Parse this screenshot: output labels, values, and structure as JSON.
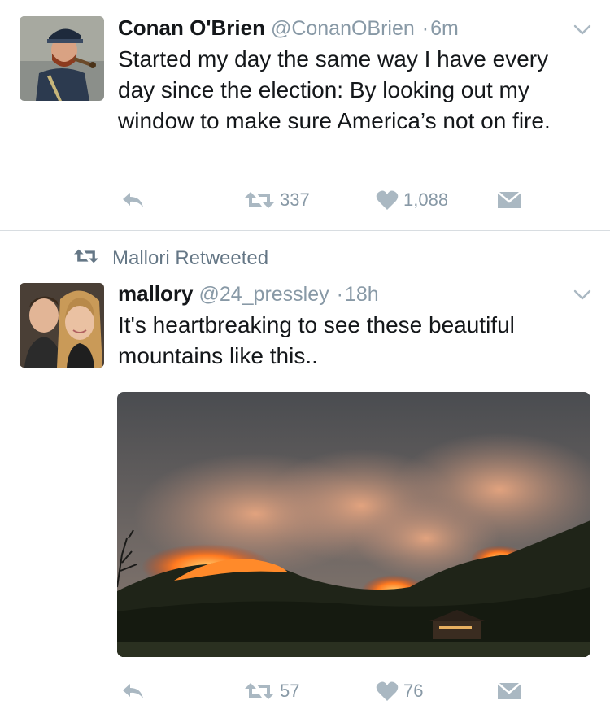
{
  "tweets": [
    {
      "avatar_icon": "user-avatar-conan",
      "name": "Conan O'Brien",
      "handle": "@ConanOBrien",
      "separator": "·",
      "time": "6m",
      "text": "Started my day the same way I have every day since the election: By looking out my window to make sure America’s not on fire.",
      "retweets": "337",
      "likes": "1,088"
    },
    {
      "retweeted_by": "Mallori Retweeted",
      "avatar_icon": "user-avatar-mallory",
      "name": "mallory",
      "handle": "@24_pressley",
      "separator": "·",
      "time": "18h",
      "text": "It's heartbreaking to see these beautiful mountains like this..",
      "media": "photo of wildfire on mountains at night",
      "retweets": "57",
      "likes": "76"
    }
  ],
  "colors": {
    "text": "#14171a",
    "muted": "#8899a6",
    "divider": "#d8dde1"
  },
  "icons": [
    "reply-icon",
    "retweet-icon",
    "heart-icon",
    "direct-message-icon",
    "chevron-down-icon"
  ]
}
